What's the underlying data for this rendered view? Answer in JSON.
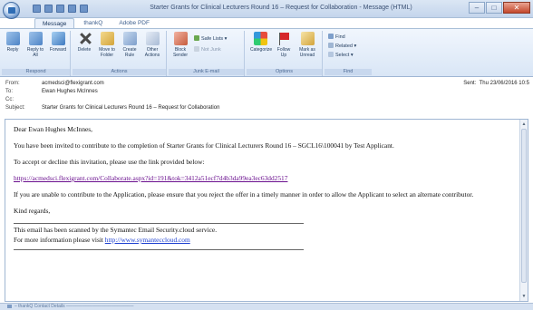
{
  "window": {
    "title": "Starter Grants for Clinical Lecturers Round 16 – Request for Collaboration - Message (HTML)",
    "minimize": "–",
    "maximize": "□",
    "close": "✕"
  },
  "tabs": [
    {
      "label": "Message",
      "active": true
    },
    {
      "label": "thankQ",
      "active": false
    },
    {
      "label": "Adobe PDF",
      "active": false
    }
  ],
  "ribbon": {
    "groups": [
      {
        "label": "Respond",
        "buttons": [
          "Reply",
          "Reply to All",
          "Forward"
        ]
      },
      {
        "label": "Actions",
        "buttons": [
          "Delete",
          "Move to Folder",
          "Create Rule",
          "Other Actions"
        ]
      },
      {
        "label": "Junk E-mail",
        "buttons": [
          "Block Sender"
        ],
        "small": [
          "Safe Lists",
          "Not Junk"
        ]
      },
      {
        "label": "Options",
        "buttons": [
          "Categorize",
          "Follow Up",
          "Mark as Unread"
        ]
      },
      {
        "label": "Find",
        "small": [
          "Find",
          "Related",
          "Select"
        ]
      }
    ]
  },
  "header": {
    "from_label": "From:",
    "from": "acmedsci@flexigrant.com",
    "to_label": "To:",
    "to": "Ewan Hughes McInnes",
    "cc_label": "Cc:",
    "cc": "",
    "subject_label": "Subject:",
    "subject": "Starter Grants for Clinical Lecturers Round 16 – Request for Collaboration",
    "sent_label": "Sent:",
    "sent": "Thu 23/06/2016 10:5"
  },
  "message": {
    "greeting": "Dear Ewan Hughes McInnes,",
    "para1": "You have been invited to contribute to the completion of Starter Grants for Clinical Lecturers Round 16 – SGCL16\\100041 by Test Applicant.",
    "para2": "To accept or decline this invitation, please use the link provided below:",
    "link": "https://acmedsci.flexigrant.com/Collaborate.aspx?id=191&tok=3412a51ecf7d4b3da99ea3ec63dd2517",
    "para3": "If you are unable to contribute to the Application, please ensure that you reject the offer in a timely manner in order to allow the Applicant to select an alternate contributor.",
    "closing": "Kind regards,",
    "scan_line1": "This email has been scanned by the Symantec Email Security.cloud service.",
    "scan_line2_prefix": "For more information please visit ",
    "scan_link": "http://www.symanteccloud.com"
  },
  "statusbar": {
    "text": "thankQ Contact Details"
  }
}
